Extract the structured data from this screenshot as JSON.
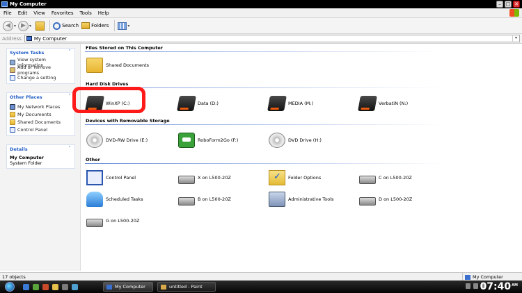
{
  "window": {
    "title": "My Computer",
    "controls": {
      "minimize": "–",
      "maximize": "□",
      "close": "✕"
    }
  },
  "menu": [
    "File",
    "Edit",
    "View",
    "Favorites",
    "Tools",
    "Help"
  ],
  "toolbar": {
    "back_label": "Back",
    "search_label": "Search",
    "folders_label": "Folders"
  },
  "address": {
    "label": "Address",
    "value": "My Computer"
  },
  "sidebar": {
    "system_tasks": {
      "title": "System Tasks",
      "items": [
        "View system information",
        "Add or remove programs",
        "Change a setting"
      ]
    },
    "other_places": {
      "title": "Other Places",
      "items": [
        "My Network Places",
        "My Documents",
        "Shared Documents",
        "Control Panel"
      ]
    },
    "details": {
      "title": "Details",
      "name": "My Computer",
      "type": "System Folder"
    }
  },
  "groups": {
    "files": {
      "title": "Files Stored on This Computer",
      "items": [
        "Shared Documents"
      ]
    },
    "hdd": {
      "title": "Hard Disk Drives",
      "items": [
        "WinXP (C:)",
        "Data (D:)",
        "MEDIA (M:)",
        "VerbatiN (N:)"
      ]
    },
    "removable": {
      "title": "Devices with Removable Storage",
      "items": [
        "DVD-RW Drive (E:)",
        "RoboForm2Go (F:)",
        "DVD Drive (H:)"
      ]
    },
    "other": {
      "title": "Other",
      "items": [
        "Control Panel",
        "X on L500-20Z",
        "Folder Options",
        "C on L500-20Z",
        "Scheduled Tasks",
        "B on L500-20Z",
        "Administrative Tools",
        "D on L500-20Z",
        "G on L500-20Z"
      ]
    }
  },
  "status": {
    "left": "17 objects",
    "right": "My Computer"
  },
  "taskbar": {
    "buttons": [
      "My Computer",
      "untitled - Paint"
    ],
    "clock": "07:40",
    "ampm": "AM"
  },
  "colors": {
    "accent": "#215dc6",
    "highlight": "#ff1a1a"
  }
}
